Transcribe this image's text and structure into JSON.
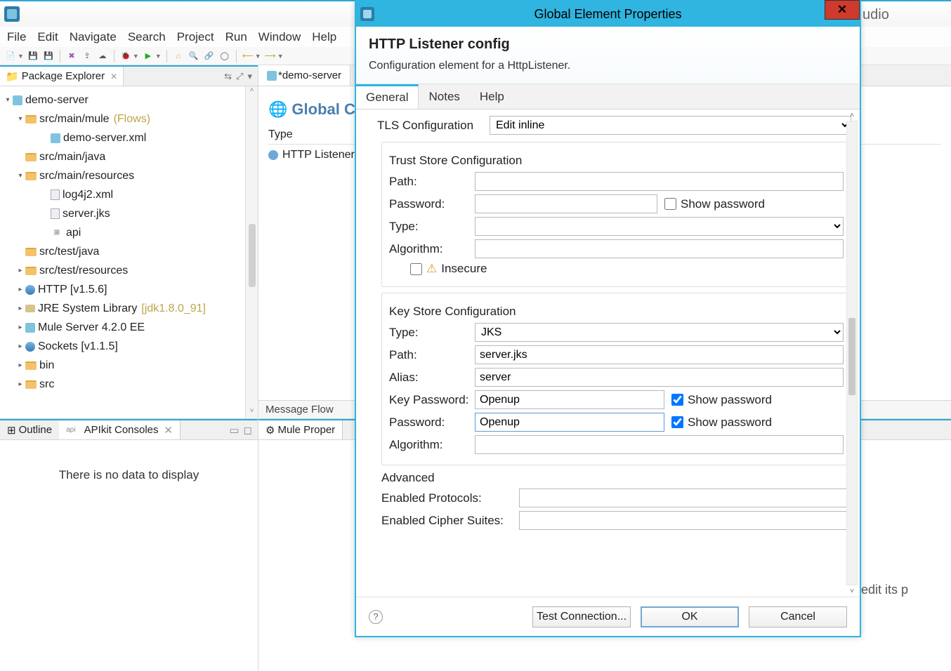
{
  "ide": {
    "title": "udio",
    "menus": [
      "File",
      "Edit",
      "Navigate",
      "Search",
      "Project",
      "Run",
      "Window",
      "Help"
    ]
  },
  "explorer": {
    "tab": "Package Explorer",
    "nodes": {
      "project": "demo-server",
      "src_main_mule": "src/main/mule",
      "flows_hint": "(Flows)",
      "demo_xml": "demo-server.xml",
      "src_main_java": "src/main/java",
      "src_main_resources": "src/main/resources",
      "log4j": "log4j2.xml",
      "server_jks": "server.jks",
      "api": "api",
      "src_test_java": "src/test/java",
      "src_test_resources": "src/test/resources",
      "http_lib": "HTTP [v1.5.6]",
      "jre_lib": "JRE System Library",
      "jre_hint": "[jdk1.8.0_91]",
      "mule_server": "Mule Server 4.2.0 EE",
      "sockets": "Sockets [v1.1.5]",
      "bin": "bin",
      "src": "src"
    }
  },
  "outline": {
    "tab1": "Outline",
    "tab2": "APIkit Consoles",
    "empty": "There is no data to display"
  },
  "editor": {
    "tab": "*demo-server",
    "heading": "Global C",
    "col_type": "Type",
    "row1": "HTTP Listener",
    "bottom_tab1": "Message Flow",
    "props_tab": "Mule Proper",
    "hidden_text": "edit its p"
  },
  "dialog": {
    "title": "Global Element Properties",
    "heading": "HTTP Listener config",
    "sub": "Configuration element for a HttpListener.",
    "tabs": {
      "general": "General",
      "notes": "Notes",
      "help": "Help"
    },
    "tls_label": "TLS Configuration",
    "tls_mode": "Edit inline",
    "trust": {
      "title": "Trust Store Configuration",
      "path_lbl": "Path:",
      "pw_lbl": "Password:",
      "showpw": "Show password",
      "type_lbl": "Type:",
      "algo_lbl": "Algorithm:",
      "insecure": "Insecure",
      "path": "",
      "pw": "",
      "type": "",
      "algo": ""
    },
    "key": {
      "title": "Key Store Configuration",
      "type_lbl": "Type:",
      "type": "JKS",
      "path_lbl": "Path:",
      "path": "server.jks",
      "alias_lbl": "Alias:",
      "alias": "server",
      "keypw_lbl": "Key Password:",
      "keypw": "Openup",
      "pw_lbl": "Password:",
      "pw": "Openup",
      "algo_lbl": "Algorithm:",
      "algo": "",
      "showpw": "Show password"
    },
    "adv": {
      "title": "Advanced",
      "proto_lbl": "Enabled Protocols:",
      "cipher_lbl": "Enabled Cipher Suites:",
      "proto": "",
      "cipher": ""
    },
    "buttons": {
      "test": "Test Connection...",
      "ok": "OK",
      "cancel": "Cancel"
    }
  }
}
